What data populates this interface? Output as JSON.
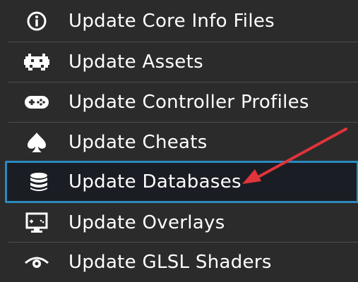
{
  "menu": {
    "items": [
      {
        "label": "Update Core Info Files",
        "icon": "info-icon"
      },
      {
        "label": "Update Assets",
        "icon": "retroarch-invader-icon"
      },
      {
        "label": "Update Controller Profiles",
        "icon": "gamepad-icon"
      },
      {
        "label": "Update Cheats",
        "icon": "spade-icon"
      },
      {
        "label": "Update Databases",
        "icon": "database-icon",
        "selected": true
      },
      {
        "label": "Update Overlays",
        "icon": "monitor-overlay-icon"
      },
      {
        "label": "Update GLSL Shaders",
        "icon": "eye-icon"
      }
    ]
  },
  "colors": {
    "background": "#2b2b2b",
    "selected_background": "#1b1d24",
    "selected_border": "#2a8ac0",
    "annotation_arrow": "#e0343a",
    "text": "#ffffff"
  }
}
